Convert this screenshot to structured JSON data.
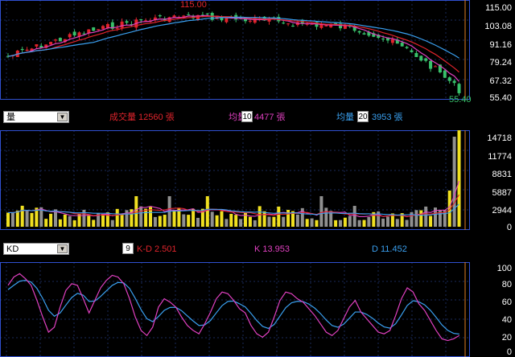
{
  "colors": {
    "up": "#e0242c",
    "down": "#38c06a",
    "ma_pink": "#e040c0",
    "ma_red": "#e0242c",
    "ma_blue": "#3aa0f0",
    "frame": "#3050d0",
    "vol_yellow": "#f0e020",
    "vol_gray": "#909090",
    "kd_k": "#e040c0",
    "kd_d": "#3aa0f0"
  },
  "price_panel": {
    "y_labels": [
      "115.00",
      "103.08",
      "91.16",
      "79.24",
      "67.32",
      "55.40"
    ],
    "high_marker": "115.00",
    "low_marker": "55.40"
  },
  "volume_toolbar": {
    "selector": "量",
    "total_volume_text": "成交量 12560 張",
    "ma1_label": "均量",
    "ma1_period": "10",
    "ma1_value": "4477 張",
    "ma2_label": "均量",
    "ma2_period": "20",
    "ma2_value": "3953 張"
  },
  "volume_panel": {
    "y_labels": [
      "14718",
      "11774",
      "8831",
      "5887",
      "2944",
      "0"
    ]
  },
  "kd_toolbar": {
    "selector": "KD",
    "period": "9",
    "kd_diff_text": "K-D 2.501",
    "k_text": "K 13.953",
    "d_text": "D 11.452"
  },
  "kd_panel": {
    "y_labels": [
      "100",
      "80",
      "60",
      "40",
      "20",
      "0"
    ]
  }
}
